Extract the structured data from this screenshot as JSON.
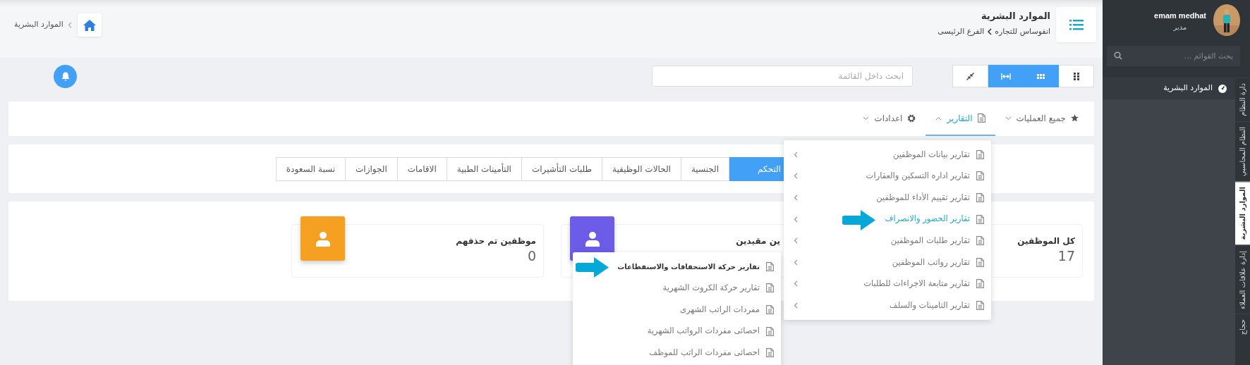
{
  "sidebar": {
    "user": {
      "name": "emam medhat",
      "role": "مدير"
    },
    "search": {
      "placeholder": "بحث القوائم ..."
    },
    "menu": [
      {
        "label": "الموارد البشرية"
      }
    ],
    "vertical_tabs": [
      {
        "label": "دارة النظام",
        "selected": false
      },
      {
        "label": "النظام المحاسبي",
        "selected": false
      },
      {
        "label": "الموارد البشرية",
        "selected": true
      },
      {
        "label": "إدارة علاقات العملاء",
        "selected": false
      },
      {
        "label": "حجاج",
        "selected": false
      }
    ]
  },
  "header": {
    "title": "الموارد البشرية",
    "breadcrumb": [
      "انفوساس للتجاره",
      "الفرع الرئيسى"
    ],
    "page_breadcrumb": "الموارد البشرية"
  },
  "toolbar": {
    "view_buttons": [
      {
        "kind": "dots",
        "selected": false
      },
      {
        "kind": "grid",
        "selected": true
      },
      {
        "kind": "expand",
        "selected": true
      },
      {
        "kind": "compress",
        "selected": false
      }
    ],
    "search": {
      "placeholder": "ابحث داخل القائمة"
    }
  },
  "nav": [
    {
      "label": "جميع العمليات",
      "kind": "star",
      "selected": false
    },
    {
      "label": "التقارير",
      "kind": "doc",
      "selected": true
    },
    {
      "label": "اعدادات",
      "kind": "gear",
      "selected": false
    }
  ],
  "tabs": [
    {
      "label": "التحكم",
      "selected": true
    },
    {
      "label": "الجنسية",
      "selected": false
    },
    {
      "label": "الحالات الوظيفية",
      "selected": false
    },
    {
      "label": "طلبات التأشيرات",
      "selected": false
    },
    {
      "label": "التأمينات الطبية",
      "selected": false
    },
    {
      "label": "الاقامات",
      "selected": false
    },
    {
      "label": "الجوازات",
      "selected": false
    },
    {
      "label": "نسبة السعودة",
      "selected": false
    }
  ],
  "stats": [
    {
      "label": "كل الموظفين",
      "value": "17"
    },
    {
      "label": "ين مقيدين",
      "color": "#6c5ce7"
    },
    {
      "label": "موظفين تم حذفهم",
      "value": "0",
      "color": "#f5a020"
    }
  ],
  "reports_menu": {
    "items": [
      {
        "label": "تقارير بيانات الموظفين",
        "selected": false,
        "arrow": false
      },
      {
        "label": "تقارير اداره التسكين والعقارات",
        "selected": false,
        "arrow": false
      },
      {
        "label": "تقارير تقييم الأداء للموظفين",
        "selected": false,
        "arrow": false
      },
      {
        "label": "تقارير الحضور والانصراف",
        "selected": true,
        "arrow": true
      },
      {
        "label": "تقارير طلبات الموظفين",
        "selected": false,
        "arrow": false
      },
      {
        "label": "تقارير رواتب الموظفين",
        "selected": false,
        "arrow": false
      },
      {
        "label": "تقارير متابعة الاجراءات للطلبات",
        "selected": false,
        "arrow": false
      },
      {
        "label": "تقارير التامينات والسلف",
        "selected": false,
        "arrow": false
      }
    ]
  },
  "submenu": {
    "items": [
      {
        "label": "تقارير حركة الاستحقاقات والاستقطاعات",
        "selected": true,
        "arrow": true
      },
      {
        "label": "تقارير حركة الكروت الشهرية",
        "selected": false,
        "arrow": false
      },
      {
        "label": "مفردات الراتب الشهرى",
        "selected": false,
        "arrow": false
      },
      {
        "label": "احصائى مفردات الرواتب الشهرية",
        "selected": false,
        "arrow": false
      },
      {
        "label": "احصائى مفردات الراتب للموظف",
        "selected": false,
        "arrow": false
      }
    ]
  }
}
